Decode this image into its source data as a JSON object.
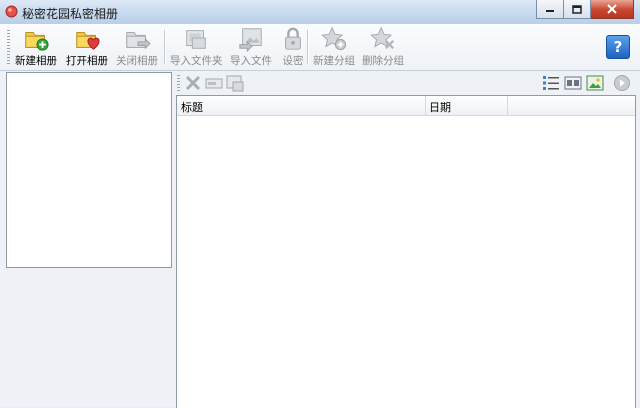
{
  "window": {
    "title": "秘密花园私密相册"
  },
  "toolbar": {
    "new_album": "新建相册",
    "open_album": "打开相册",
    "close_album": "关闭相册",
    "import_folder": "导入文件夹",
    "import_file": "导入文件",
    "set_password": "设密",
    "new_group": "新建分组",
    "delete_group": "删除分组",
    "help": "?"
  },
  "list": {
    "columns": [
      "标题",
      "日期"
    ],
    "rows": []
  },
  "colors": {
    "titlebar": "#c9dcf0",
    "close_button": "#c8472e",
    "help_button": "#1c63c4"
  }
}
